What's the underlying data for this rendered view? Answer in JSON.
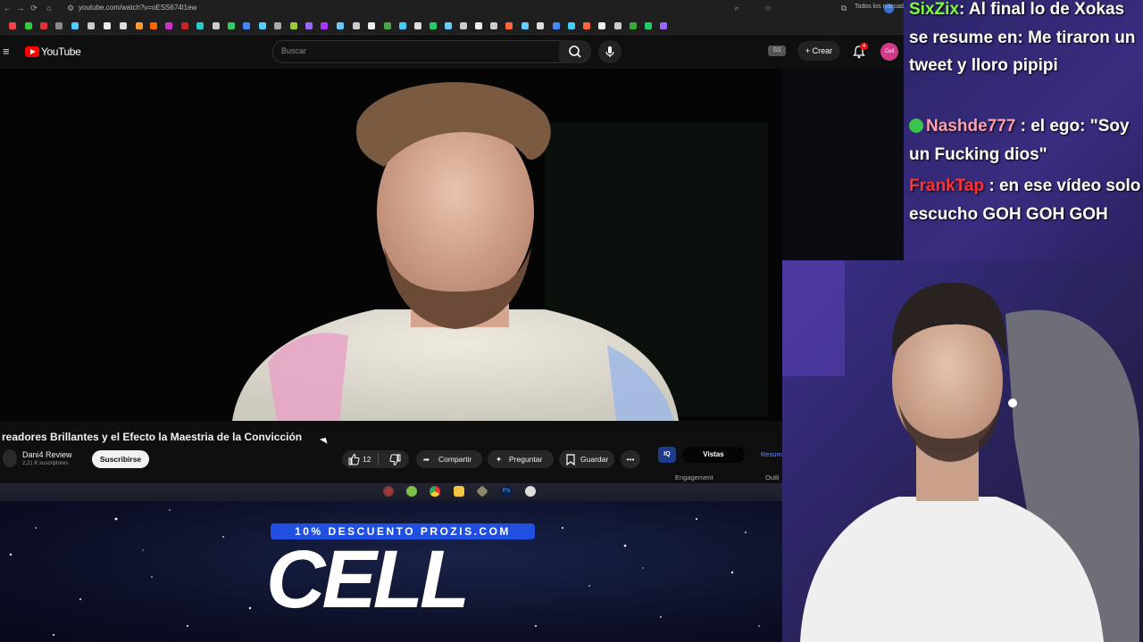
{
  "browser": {
    "url": "youtube.com/watch?v=oESS674l1ew",
    "bookmarks_all": "Todos los marcadores"
  },
  "youtube": {
    "logo_text": "YouTube",
    "search_placeholder": "Buscar",
    "ss_badge": "SS",
    "create_label": "+ Crear",
    "notifications_count": "4",
    "avatar_text": "Cell"
  },
  "video": {
    "title": "readores Brillantes y el Efecto la Maestria de la Convicción",
    "channel_name": "Dani4 Review",
    "subscribers": "2,21 K suscriptores",
    "subscribe_label": "Suscribirse",
    "likes": "12",
    "share_label": "Compartir",
    "ask_label": "Preguntar",
    "save_label": "Guardar",
    "more_label": "•••"
  },
  "extension": {
    "iq_label": "IQ",
    "views_tab": "Vistas",
    "resume_tab": "Resum",
    "engagement_label": "Engagement",
    "outline_label": "Outli"
  },
  "sponsor": {
    "banner": "10% DESCUENTO PROZIS.COM",
    "brand": "CELL"
  },
  "chat": [
    {
      "user": "SixZix",
      "color": "#7fff3a",
      "message": ": Al final lo de Xokas se resume en: Me tiraron un tweet y lloro pipipi",
      "badge": false
    },
    {
      "user": "Nashde777",
      "color": "#ff9fb0",
      "message": " : el ego: \"Soy un Fucking dios\"",
      "badge": true
    },
    {
      "user": "FrankTap",
      "color": "#ff3333",
      "message": " : en ese vídeo solo escucho GOH GOH GOH",
      "badge": false
    }
  ],
  "colors": {
    "youtube_red": "#ff0000",
    "sponsor_blue": "#2150e0",
    "chat_bg": "#2a2568"
  }
}
